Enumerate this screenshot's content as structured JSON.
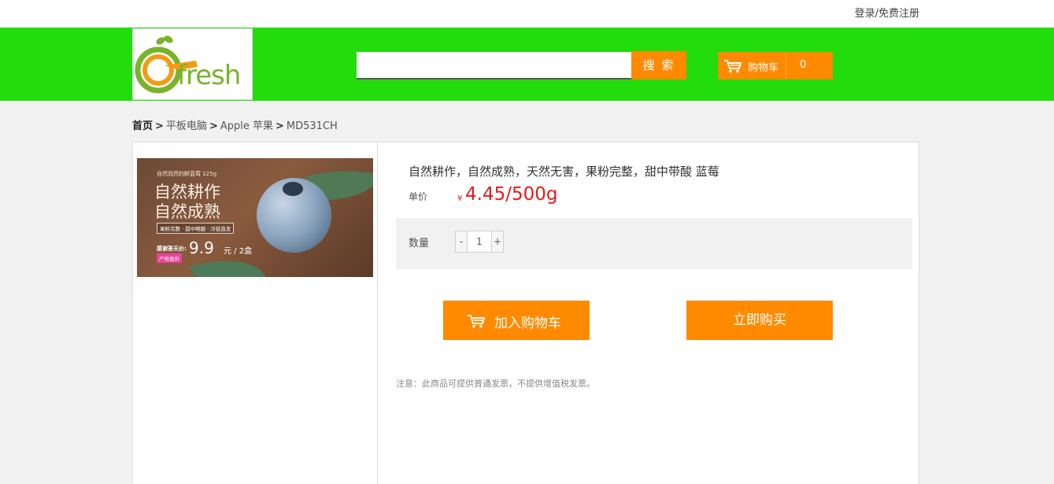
{
  "topbar": {
    "login_text": "登录/免费注册"
  },
  "header": {
    "logo_text": "fresh",
    "search_placeholder": "",
    "search_label": "搜 索",
    "cart_label": "购物车",
    "cart_count": "0"
  },
  "breadcrumb": {
    "home": "首页",
    "items": [
      "平板电脑",
      "Apple 苹果",
      "MD531CH"
    ]
  },
  "product": {
    "image_text": {
      "small": "自然而然的鲜蓝莓 125g",
      "line1": "自然耕作",
      "line2": "自然成熟",
      "tag": "果粉完整 · 甜中略酸 · 冷链直发",
      "thanks": "感谢答天价:",
      "price": "9.9",
      "unit": "元 / 2盒",
      "badge": "产地直供"
    },
    "title": "自然耕作，自然成熟，天然无害，果粉完整，甜中带酸 蓝莓",
    "price_label": "单价",
    "currency": "¥",
    "price": "4.45/500g",
    "quantity_label": "数量",
    "quantity_minus": "-",
    "quantity_value": "1",
    "quantity_plus": "+",
    "add_to_cart_label": "加入购物车",
    "buy_now_label": "立即购买",
    "notice": "注意：此商品可提供普通发票，不提供增值税发票。"
  },
  "colors": {
    "header_green": "#22dc0c",
    "accent_orange": "#ff8a00",
    "price_red": "#e41a1a"
  }
}
